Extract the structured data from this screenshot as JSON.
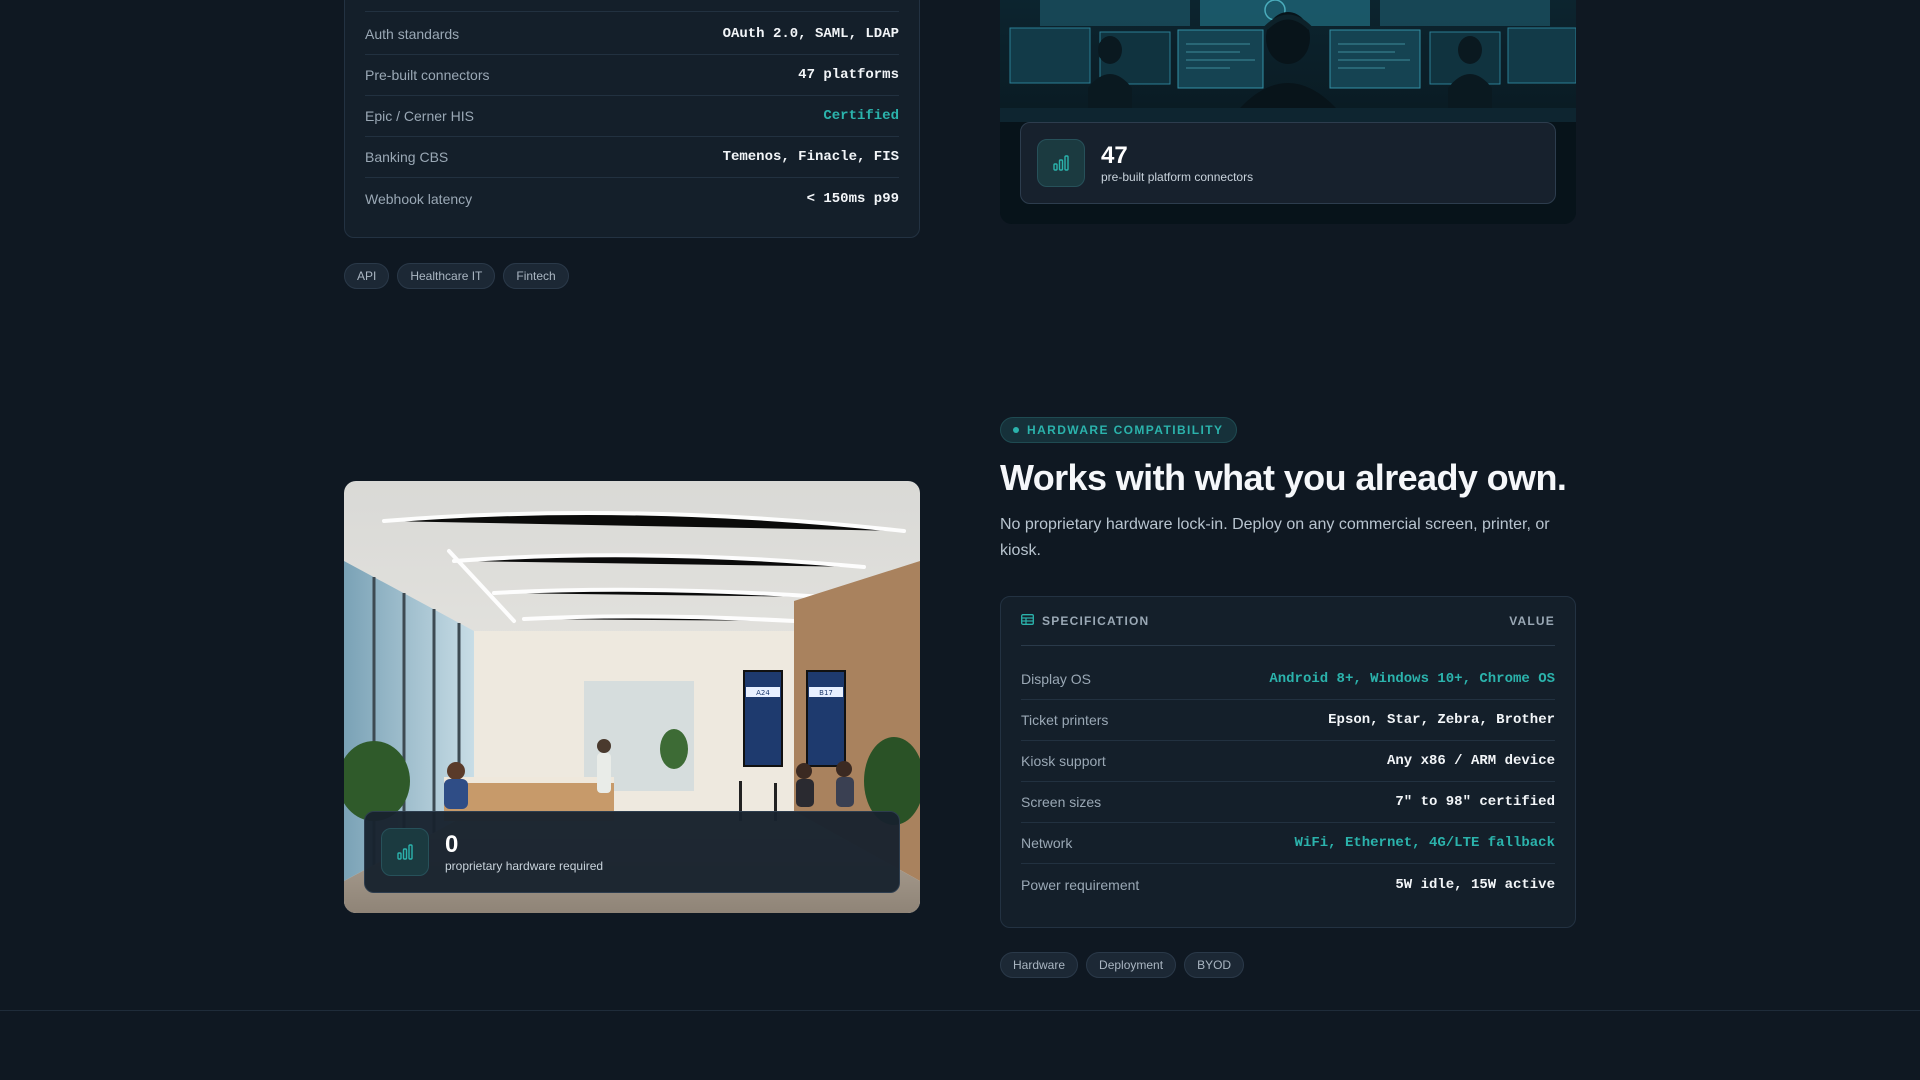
{
  "integration_specs": {
    "rows": [
      {
        "label": "Auth standards",
        "value": "OAuth 2.0, SAML, LDAP"
      },
      {
        "label": "Pre-built connectors",
        "value": "47 platforms"
      },
      {
        "label": "Epic / Cerner HIS",
        "value": "Certified"
      },
      {
        "label": "Banking CBS",
        "value": "Temenos, Finacle, FIS"
      },
      {
        "label": "Webhook latency",
        "value": "< 150ms p99"
      }
    ],
    "tags": [
      "API",
      "Healthcare IT",
      "Fintech"
    ]
  },
  "ops_image": {
    "stat_number": "47",
    "stat_caption": "pre-built platform connectors"
  },
  "lobby_image": {
    "stat_number": "0",
    "stat_caption": "proprietary hardware required",
    "screen_left_code": "A24",
    "screen_right_code": "B17"
  },
  "hardware": {
    "eyebrow": "HARDWARE COMPATIBILITY",
    "headline": "Works with what you already own.",
    "subcopy": "No proprietary hardware lock-in. Deploy on any commercial screen, printer, or kiosk.",
    "table_head_left": "SPECIFICATION",
    "table_head_right": "VALUE",
    "rows": [
      {
        "label": "Display OS",
        "value": "Android 8+, Windows 10+, Chrome OS"
      },
      {
        "label": "Ticket printers",
        "value": "Epson, Star, Zebra, Brother"
      },
      {
        "label": "Kiosk support",
        "value": "Any x86 / ARM device"
      },
      {
        "label": "Screen sizes",
        "value": "7\" to 98\" certified"
      },
      {
        "label": "Network",
        "value": "WiFi, Ethernet, 4G/LTE fallback"
      },
      {
        "label": "Power requirement",
        "value": "5W idle, 15W active"
      }
    ],
    "tags": [
      "Hardware",
      "Deployment",
      "BYOD"
    ]
  },
  "colors": {
    "accent": "#2bb3ac",
    "background": "#0f1822",
    "card": "#141f2a"
  },
  "icons": {
    "stat": "bar-chart-icon",
    "table": "table-icon"
  }
}
